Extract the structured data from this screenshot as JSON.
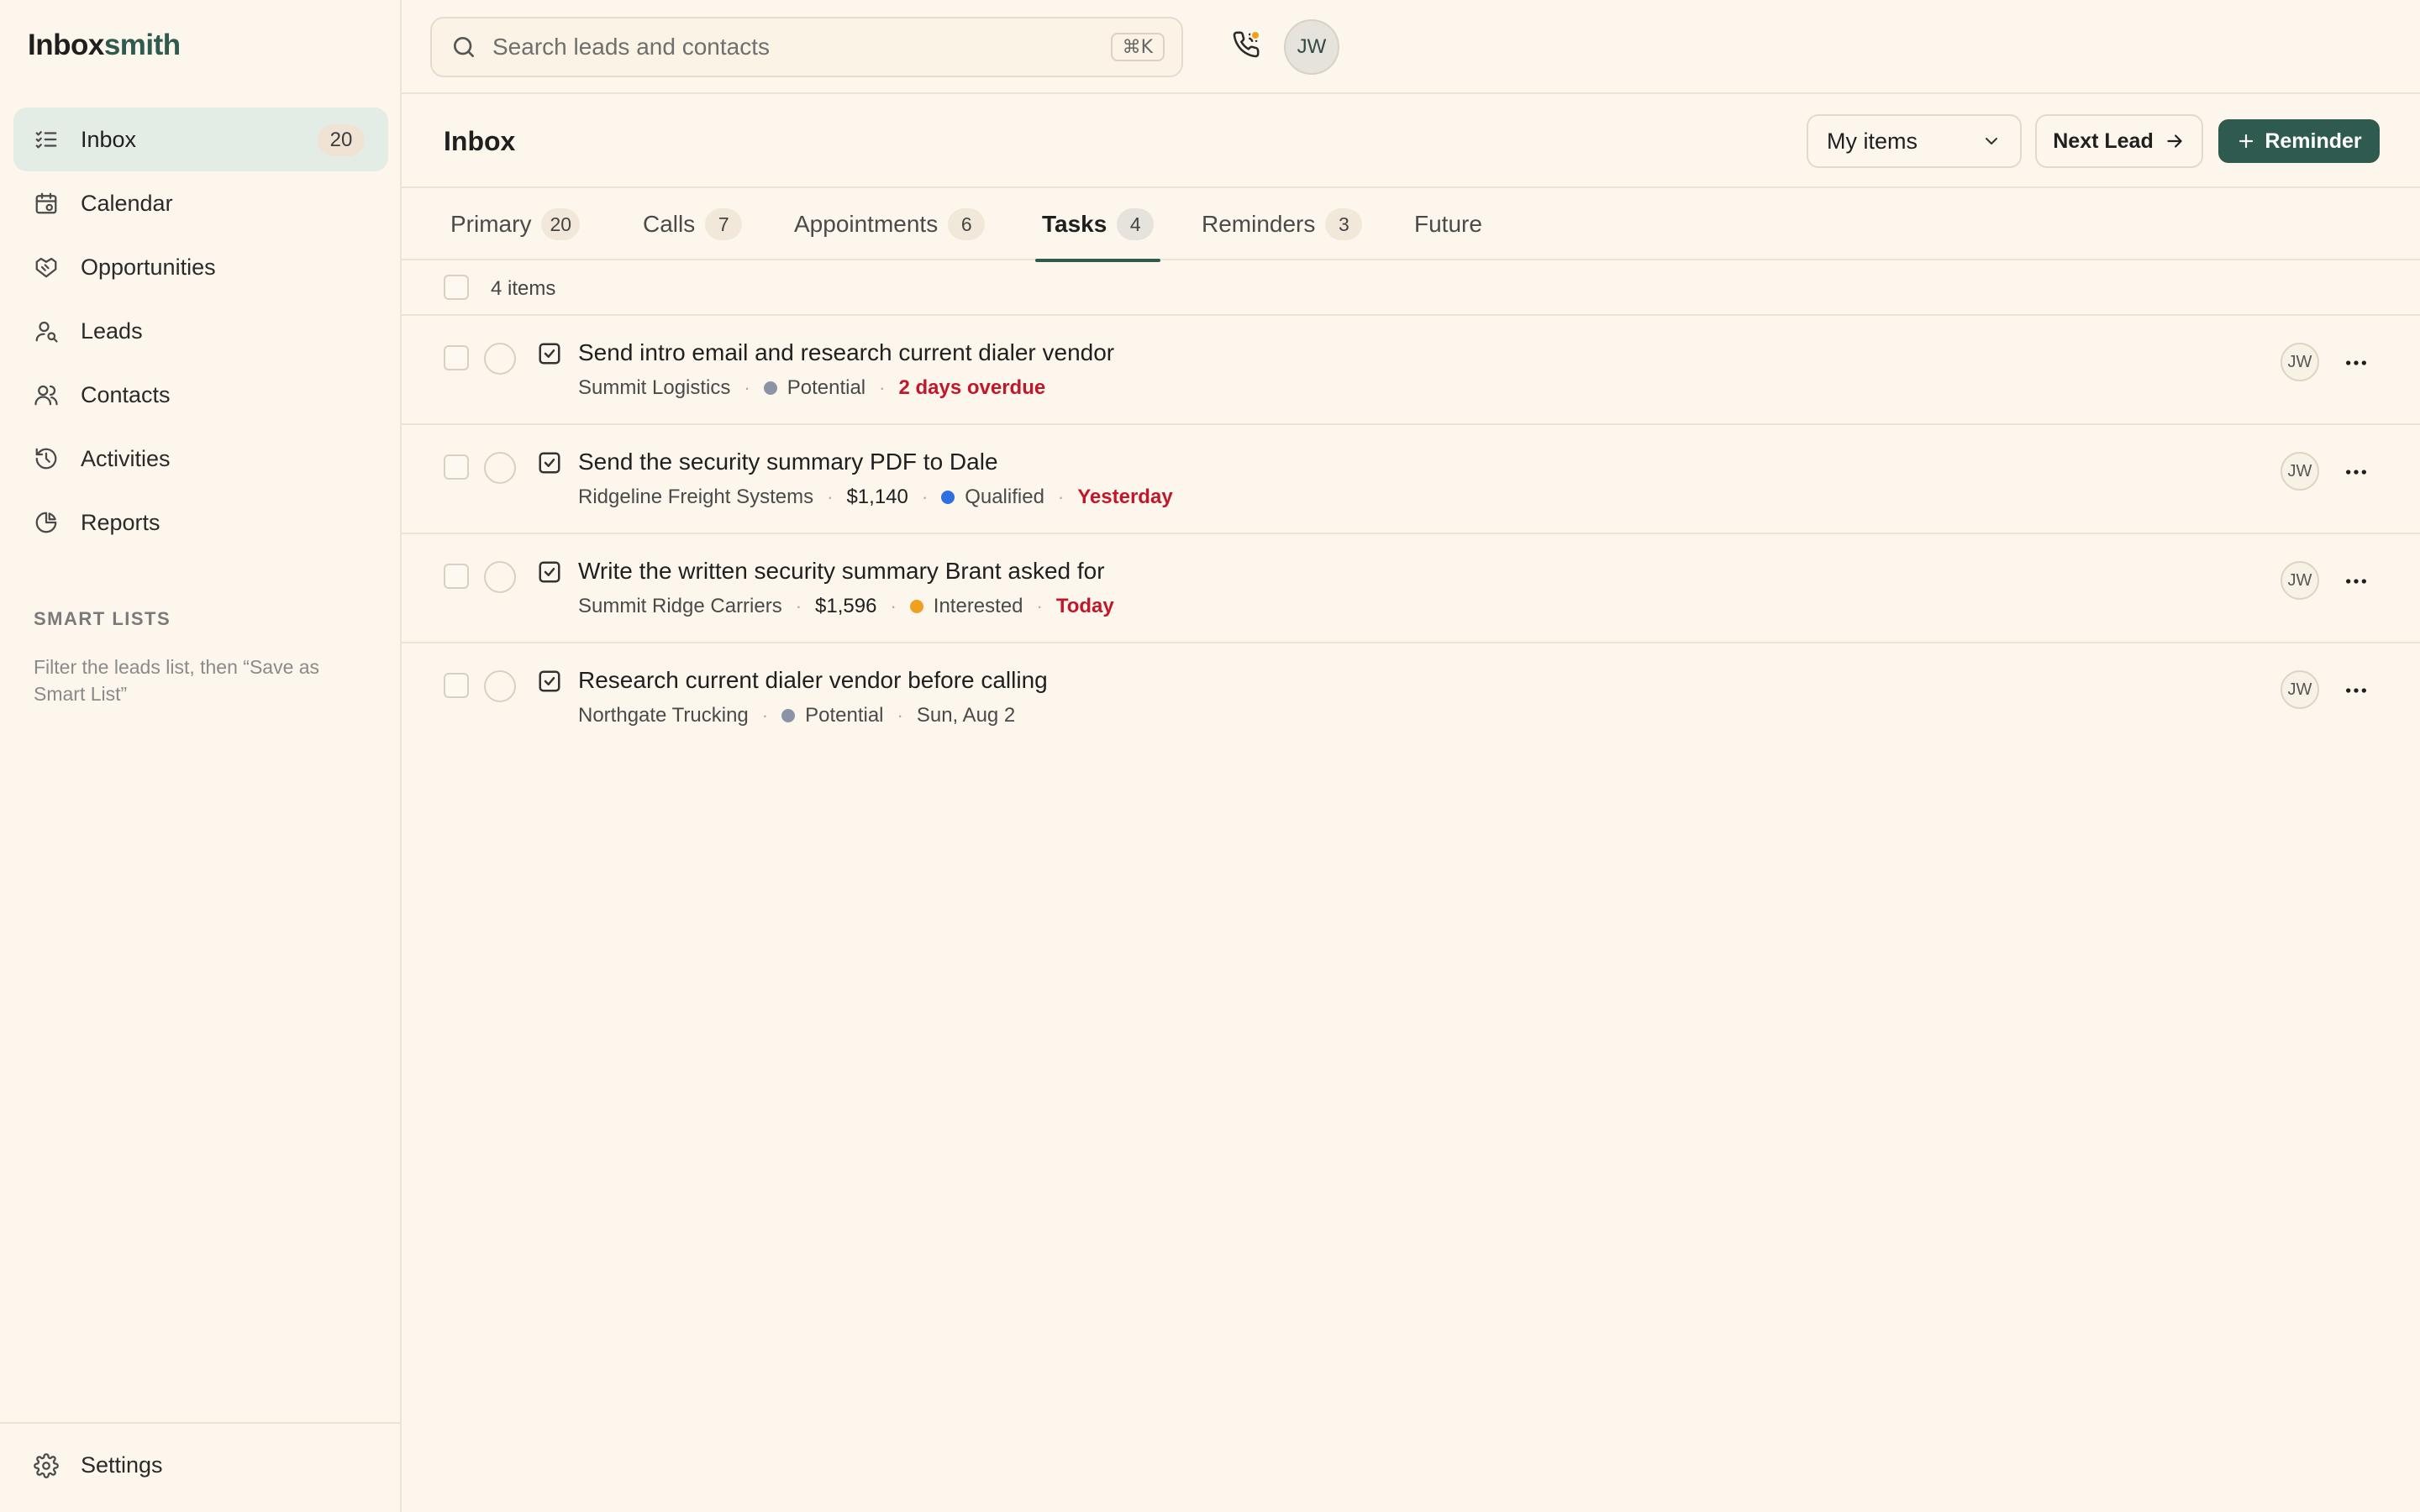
{
  "app": {
    "logo_main": "Inbox",
    "logo_accent": "smith",
    "accent_color": "#2f5a4f"
  },
  "sidebar": {
    "items": [
      {
        "label": "Inbox",
        "icon": "list-check-icon",
        "badge": "20",
        "active": true
      },
      {
        "label": "Calendar",
        "icon": "calendar-icon"
      },
      {
        "label": "Opportunities",
        "icon": "handshake-icon"
      },
      {
        "label": "Leads",
        "icon": "user-search-icon"
      },
      {
        "label": "Contacts",
        "icon": "users-icon"
      },
      {
        "label": "Activities",
        "icon": "history-icon"
      },
      {
        "label": "Reports",
        "icon": "pie-chart-icon"
      }
    ],
    "smart_lists_title": "SMART LISTS",
    "smart_lists_hint": "Filter the leads list, then “Save as Smart List”",
    "settings_label": "Settings"
  },
  "topbar": {
    "search_placeholder": "Search leads and contacts",
    "search_shortcut": "⌘K",
    "user_initials": "JW",
    "notification_color": "#f0a020"
  },
  "header": {
    "title": "Inbox",
    "filter_selected": "My items",
    "next_lead_label": "Next Lead",
    "reminder_label": "Reminder"
  },
  "tabs": [
    {
      "label": "Primary",
      "count": "20"
    },
    {
      "label": "Calls",
      "count": "7"
    },
    {
      "label": "Appointments",
      "count": "6"
    },
    {
      "label": "Tasks",
      "count": "4",
      "active": true
    },
    {
      "label": "Reminders",
      "count": "3"
    },
    {
      "label": "Future"
    }
  ],
  "list": {
    "items_count": "4 items",
    "rows": [
      {
        "title": "Send intro email and research current dialer vendor",
        "company": "Summit Logistics",
        "status": "Potential",
        "status_color": "#8a94a6",
        "due": "2 days overdue",
        "due_style": "overdue",
        "assignee": "JW"
      },
      {
        "title": "Send the security summary PDF to Dale",
        "company": "Ridgeline Freight Systems",
        "amount": "$1,140",
        "status": "Qualified",
        "status_color": "#2f6fe0",
        "due": "Yesterday",
        "due_style": "overdue",
        "assignee": "JW"
      },
      {
        "title": "Write the written security summary Brant asked for",
        "company": "Summit Ridge Carriers",
        "amount": "$1,596",
        "status": "Interested",
        "status_color": "#f0a020",
        "due": "Today",
        "due_style": "overdue",
        "assignee": "JW"
      },
      {
        "title": "Research current dialer vendor before calling",
        "company": "Northgate Trucking",
        "status": "Potential",
        "status_color": "#8a94a6",
        "due": "Sun, Aug 2",
        "due_style": "plain",
        "assignee": "JW"
      }
    ]
  }
}
